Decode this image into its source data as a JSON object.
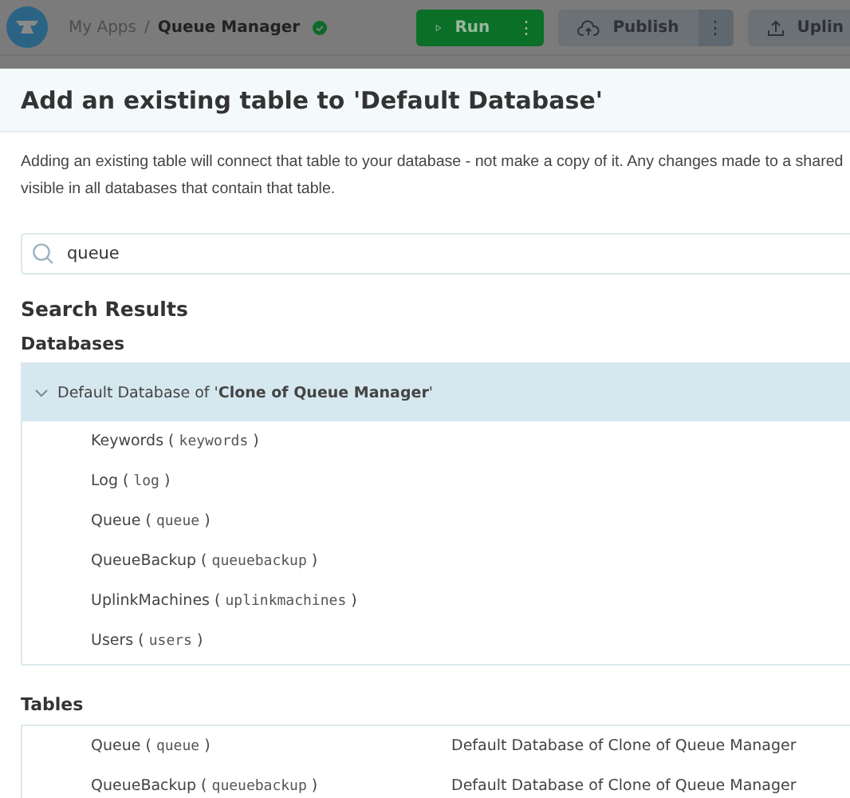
{
  "top_bar": {
    "breadcrumb": [
      "My Apps",
      "Queue Manager"
    ],
    "separator": "/",
    "menu_glyph": "⋮",
    "buttons": [
      {
        "kind": "run",
        "label": "Run"
      },
      {
        "kind": "publish",
        "label": "Publish"
      },
      {
        "kind": "uplink",
        "label": "Uplin"
      }
    ]
  },
  "dialog": {
    "title": "Add an existing table to 'Default Database'",
    "description_lines": [
      "Adding an existing table will connect that table to your database - not make a copy of it. Any changes made to a shared",
      "visible in all databases that contain that table."
    ],
    "brackets": [
      "(",
      ")"
    ],
    "search": {
      "value": "queue"
    },
    "results_heading": "Search Results",
    "databases_heading": "Databases",
    "databases": [
      {
        "label": "Default Database of '**Clone of Queue Manager**'",
        "expanded": true,
        "children": [
          {
            "name": "Keywords",
            "id": "keywords"
          },
          {
            "name": "Log",
            "id": "log"
          },
          {
            "name": "Queue",
            "id": "queue"
          },
          {
            "name": "QueueBackup",
            "id": "queuebackup"
          },
          {
            "name": "UplinkMachines",
            "id": "uplinkmachines"
          },
          {
            "name": "Users",
            "id": "users"
          }
        ]
      }
    ],
    "tables_heading": "Tables",
    "tables": [
      {
        "name": "Queue",
        "id": "queue",
        "database": "Default Database of Clone of Queue Manager"
      },
      {
        "name": "QueueBackup",
        "id": "queuebackup",
        "database": "Default Database of Clone of Queue Manager"
      }
    ]
  }
}
